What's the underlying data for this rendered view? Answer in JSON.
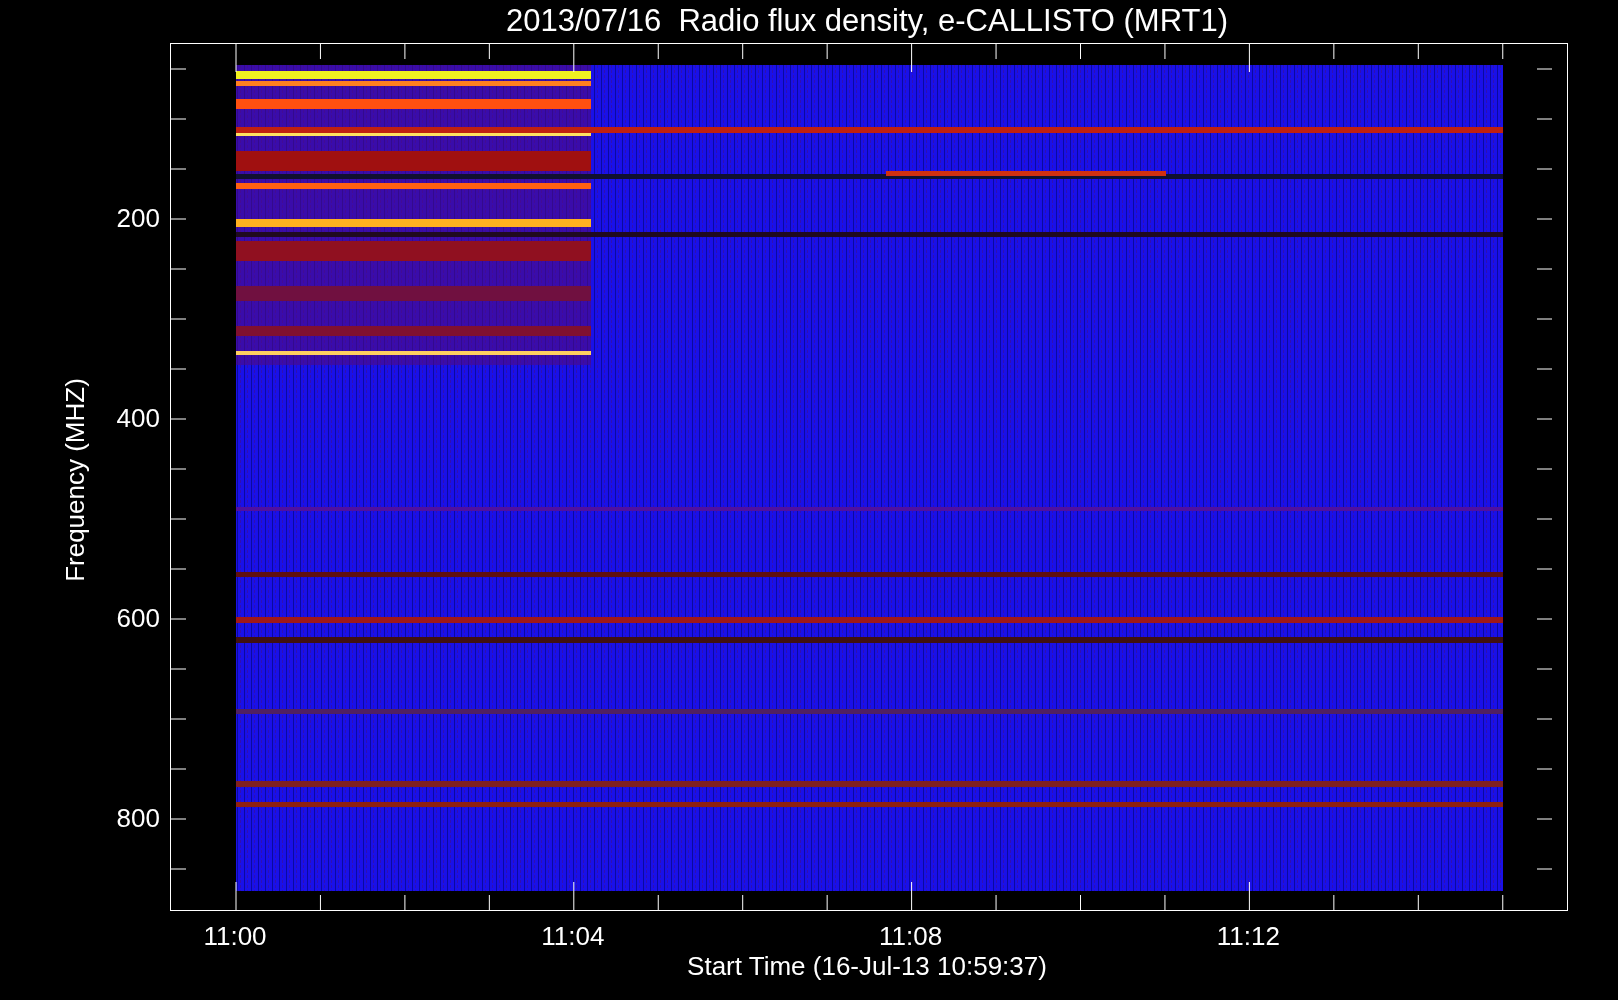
{
  "title": "2013/07/16  Radio flux density, e-CALLISTO (MRT1)",
  "plot": {
    "xlabel": "Start Time (16-Jul-13 10:59:37)",
    "ylabel": "Frequency (MHZ)",
    "xticks": [
      "11:00",
      "11:04",
      "11:08",
      "11:12"
    ],
    "yticks": [
      "200",
      "400",
      "600",
      "800"
    ]
  }
}
